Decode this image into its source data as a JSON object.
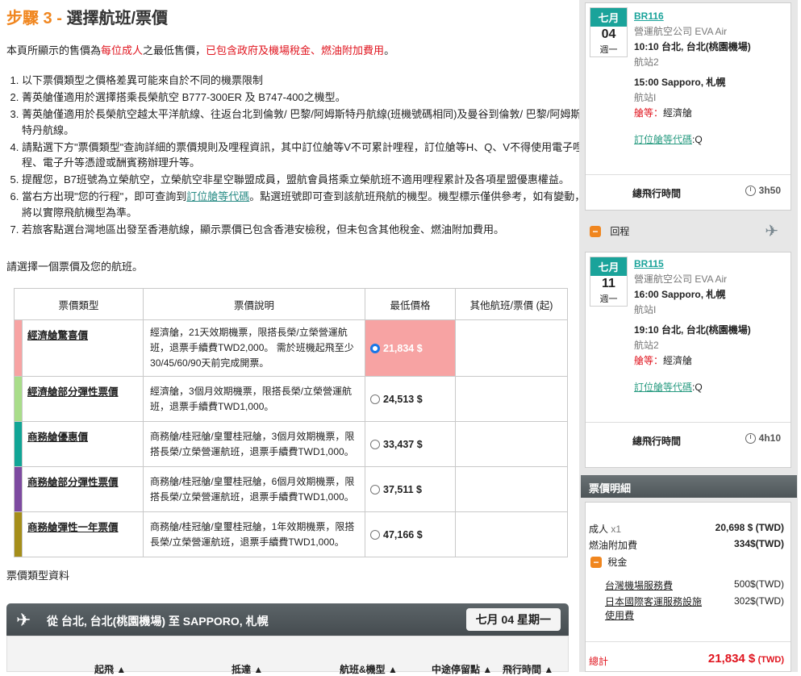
{
  "step": {
    "num": "步驟 3 - ",
    "title": "選擇航班/票價"
  },
  "intro": {
    "a": "本頁所顯示的售價為",
    "b": "每位成人",
    "c": "之最低售價，",
    "d": "已包含政府及機場稅金、燃油附加費用",
    "e": "。"
  },
  "notes": [
    "以下票價類型之價格差異可能來自於不同的機票限制",
    "菁英艙僅適用於選擇搭乘長榮航空 B777-300ER 及 B747-400之機型。",
    "菁英艙僅適用於長榮航空越太平洋航線、往返台北到倫敦/ 巴黎/阿姆斯特丹航線(班機號碼相同)及曼谷到倫敦/ 巴黎/阿姆斯特丹航線。",
    "請點選下方\"票價類型\"查詢詳細的票價規則及哩程資訊，其中訂位艙等V不可累計哩程，訂位艙等H、Q、V不得使用電子哩程、電子升等憑證或酬賓務辦理升等。",
    "提醒您，B7班號為立榮航空，立榮航空非星空聯盟成員，盟航會員搭乘立榮航班不適用哩程累計及各項星盟優惠權益。",
    {
      "pre": "當右方出現\"您的行程\"，即可查詢到",
      "link": "訂位艙等代碼",
      "post": "。點選班號即可查到該航班飛航的機型。機型標示僅供參考，如有變動，將以實際飛航機型為準。"
    },
    "若旅客點選台灣地區出發至香港航線，顯示票價已包含香港安檢稅，但未包含其他稅金、燃油附加費用。"
  ],
  "select_prompt": "請選擇一個票價及您的航班。",
  "fare_table": {
    "headers": [
      "票價類型",
      "票價說明",
      "最低價格",
      "其他航班/票價 (起)"
    ],
    "rows": [
      {
        "type": "經濟艙驚喜價",
        "color": "#f7a3a3",
        "desc": "經濟艙，21天效期機票，限搭長榮/立榮營運航班，退票手續費TWD2,000。 需於班機起飛至少30/45/60/90天前完成開票。",
        "price": "21,834 $",
        "selected": true
      },
      {
        "type": "經濟艙部分彈性票價",
        "color": "#a9dd8a",
        "desc": "經濟艙，3個月效期機票，限搭長榮/立榮營運航班，退票手續費TWD1,000。",
        "price": "24,513 $",
        "selected": false
      },
      {
        "type": "商務艙優惠價",
        "color": "#10a596",
        "desc": "商務艙/桂冠艙/皇璽桂冠艙，3個月效期機票，限搭長榮/立榮營運航班，退票手續費TWD1,000。",
        "price": "33,437 $",
        "selected": false
      },
      {
        "type": "商務艙部分彈性票價",
        "color": "#7d4aa0",
        "desc": "商務艙/桂冠艙/皇璽桂冠艙，6個月效期機票，限搭長榮/立榮營運航班，退票手續費TWD1,000。",
        "price": "37,511 $",
        "selected": false
      },
      {
        "type": "商務艙彈性一年票價",
        "color": "#a58e1a",
        "desc": "商務艙/桂冠艙/皇璽桂冠艙，1年效期機票，限搭長榮/立榮營運航班，退票手續費TWD1,000。",
        "price": "47,166 $",
        "selected": false
      }
    ]
  },
  "fare_type_info": "票價類型資料",
  "flight_bar": {
    "from": "從",
    "origin": "台北, 台北(桃園機場)",
    "to": "至",
    "dest": "SAPPORO, 札幌",
    "date": "七月 04 星期一",
    "columns": [
      "起飛",
      "抵達",
      "航班&機型",
      "中途停留點",
      "飛行時間"
    ]
  },
  "outbound": {
    "month": "七月",
    "day": "04",
    "weekday": "週一",
    "flight": "BR116",
    "airline": "營運航空公司  EVA Air",
    "dep": "10:10 台北, 台北(桃園機場)",
    "dep_terminal": "航站2",
    "arr": "15:00 Sapporo, 札幌",
    "arr_terminal": "航站I",
    "cabin_label": "艙等：",
    "cabin": "經濟艙",
    "code_label": "訂位艙等代碼",
    "code": ":Q",
    "total_label": "總飛行時間",
    "total": "3h50"
  },
  "return_label": "回程",
  "inbound": {
    "month": "七月",
    "day": "11",
    "weekday": "週一",
    "flight": "BR115",
    "airline": "營運航空公司  EVA Air",
    "dep": "16:00 Sapporo, 札幌",
    "dep_terminal": "航站I",
    "arr": "19:10 台北, 台北(桃園機場)",
    "arr_terminal": "航站2",
    "cabin_label": "艙等：",
    "cabin": "經濟艙",
    "code_label": "訂位艙等代碼",
    "code": ":Q",
    "total_label": "總飛行時間",
    "total": "4h10"
  },
  "price_detail": {
    "title": "票價明細",
    "adult_label": "成人",
    "adult_count": "x1",
    "adult_value": "20,698 $ (TWD)",
    "fuel_label": "燃油附加費",
    "fuel_value": "334$(TWD)",
    "tax_label": "稅金",
    "tw_label": "台灣機場服務費",
    "tw_value": "500$(TWD)",
    "jp_label": "日本國際客運服務設施使用費",
    "jp_value": "302$(TWD)",
    "total_label": "總計",
    "total_value": "21,834 $",
    "total_unit": "(TWD)"
  }
}
